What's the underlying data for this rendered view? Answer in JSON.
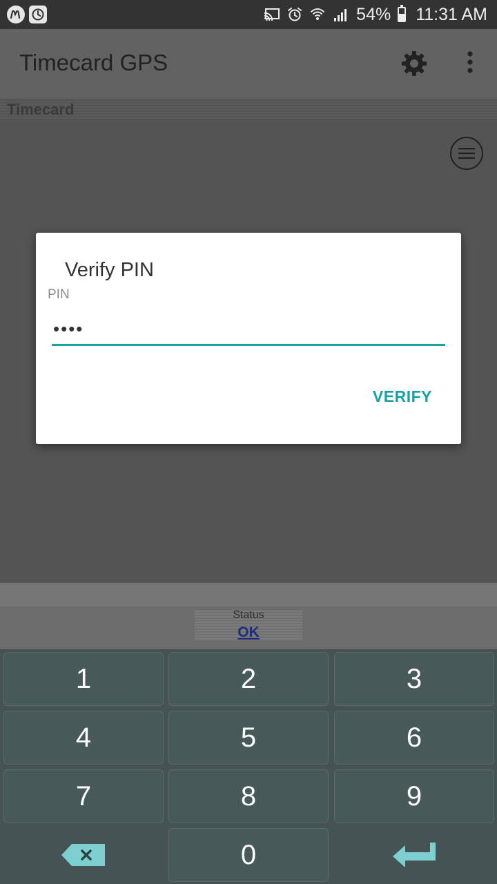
{
  "status_bar": {
    "battery_text": "54%",
    "battery_level": 0.54,
    "time": "11:31 AM",
    "icons": [
      "m-app-icon",
      "clock-app-icon",
      "cast-icon",
      "alarm-icon",
      "wifi-icon",
      "signal-icon",
      "battery-icon"
    ]
  },
  "app_bar": {
    "title": "Timecard GPS",
    "icons": [
      "gear-icon",
      "more-vert-icon"
    ]
  },
  "section": {
    "label": "Timecard"
  },
  "dialog": {
    "title": "Verify PIN",
    "field_label": "PIN",
    "field_value": "••••",
    "action_label": "VERIFY"
  },
  "status_panel": {
    "label": "Status",
    "value": "OK"
  },
  "keypad": {
    "keys": [
      "1",
      "2",
      "3",
      "4",
      "5",
      "6",
      "7",
      "8",
      "9",
      "0"
    ],
    "special_icons": [
      "backspace-icon",
      "enter-icon"
    ]
  },
  "colors": {
    "accent": "#16a3a3",
    "status_value": "#1f2c7a",
    "keypad_bg": "#455354",
    "key_icon": "#7ecfcf"
  }
}
